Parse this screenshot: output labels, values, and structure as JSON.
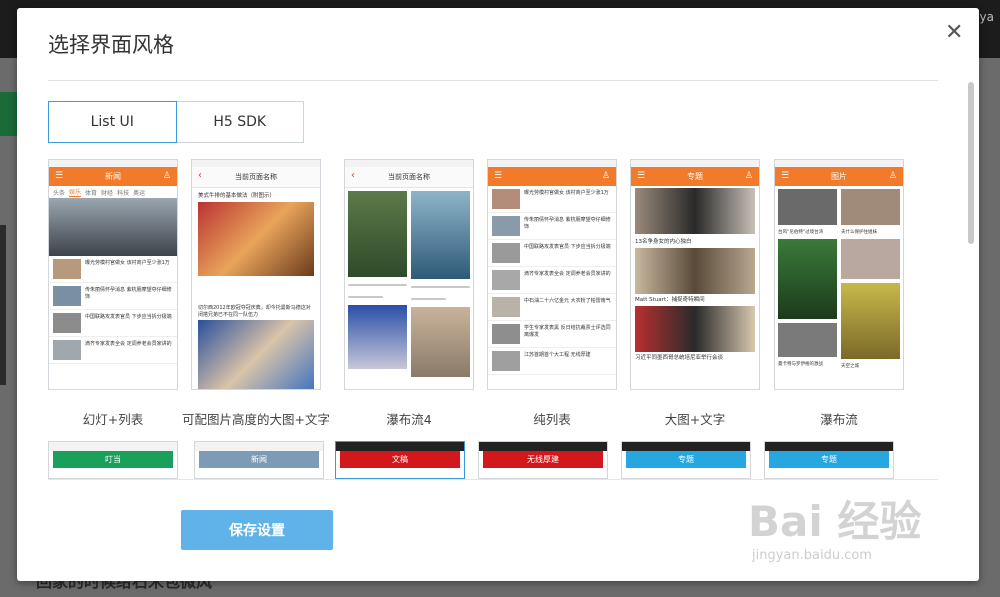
{
  "backdrop": {
    "user_name": "Miya",
    "bottom_text": "回家的时候给石米包微风"
  },
  "modal": {
    "title": "选择界面风格",
    "close_symbol": "✕",
    "tabs": [
      {
        "label": "List UI",
        "active": true
      },
      {
        "label": "H5 SDK",
        "active": false
      }
    ],
    "styles": [
      {
        "label": "幻灯+列表",
        "header_title": "新闻",
        "accent": "#f17b2a"
      },
      {
        "label": "可配图片高度的大图+文字",
        "header_title": "当前页面名称",
        "accent": "#e33"
      },
      {
        "label": "瀑布流4",
        "header_title": "当前页面名称",
        "accent": "#e33"
      },
      {
        "label": "纯列表",
        "header_title": "",
        "accent": "#f17b2a"
      },
      {
        "label": "大图+文字",
        "header_title": "专题",
        "accent": "#f17b2a"
      },
      {
        "label": "瀑布流",
        "header_title": "图片",
        "accent": "#f17b2a"
      }
    ],
    "styles_row2": [
      {
        "header_title": "叮当",
        "accent": "#1aa05a"
      },
      {
        "header_title": "新闻",
        "accent": "#7d9bb5"
      },
      {
        "header_title": "文稿",
        "accent": "#d3181c"
      },
      {
        "header_title": "无线厚建",
        "accent": "#d3181c"
      },
      {
        "header_title": "专题",
        "accent": "#27a7e0"
      },
      {
        "header_title": "专题",
        "accent": "#27a7e0"
      }
    ],
    "preview_text": {
      "s1_tabs": [
        "头条",
        "娱乐",
        "体育",
        "财经",
        "科技",
        "奥运"
      ],
      "s1_items": [
        "曝光劳模村官做女 该村商户至少涨1万",
        "传朱丽倩怀孕消息 紫杭朋摩望夺仔细修饰",
        "中国联路攻发表官员 下步应当拆分极端",
        "滴齐专家发表全会 定调养老会员家讲的"
      ],
      "s2_caption": "美式牛排的基本做法（附图示）",
      "s2_text": "切尔西2012年欧冠夺冠庆典，却今托曼斯马德这对闭搭兄弟已不在同一队伍力",
      "s4_items": [
        "曝光劳模村官做女 该村商户至少涨1万",
        "传朱丽倩怀孕消息 紫杭朋摩望夺仔细修饰",
        "中国联路攻发表官员 下步应当拆分极端",
        "滴齐专家发表全会 定调养老会员家讲的",
        "中石油二十六亿金元 大农粉了帕雷南气",
        "学生专家发表黑 反日结抗裁票士评选同离爆发",
        "江苏首期首个大工程 无线厚建"
      ],
      "s5_caption1": "13名争身女的内心独白",
      "s5_caption2": "Matt Stuart：捕捉奇特瞬间",
      "s5_caption3": "习近平同墨西哥总统培尼亚举行会谈",
      "s6_captions": [
        "台风“尼伯特”过境台湾",
        "夫什么保护住姐妹",
        "曼卡特与罗伊格的激战",
        "天空之城"
      ]
    },
    "save_label": "保存设置"
  },
  "watermark": {
    "text": "Bai 经验",
    "sub": "jingyan.baidu.com"
  }
}
